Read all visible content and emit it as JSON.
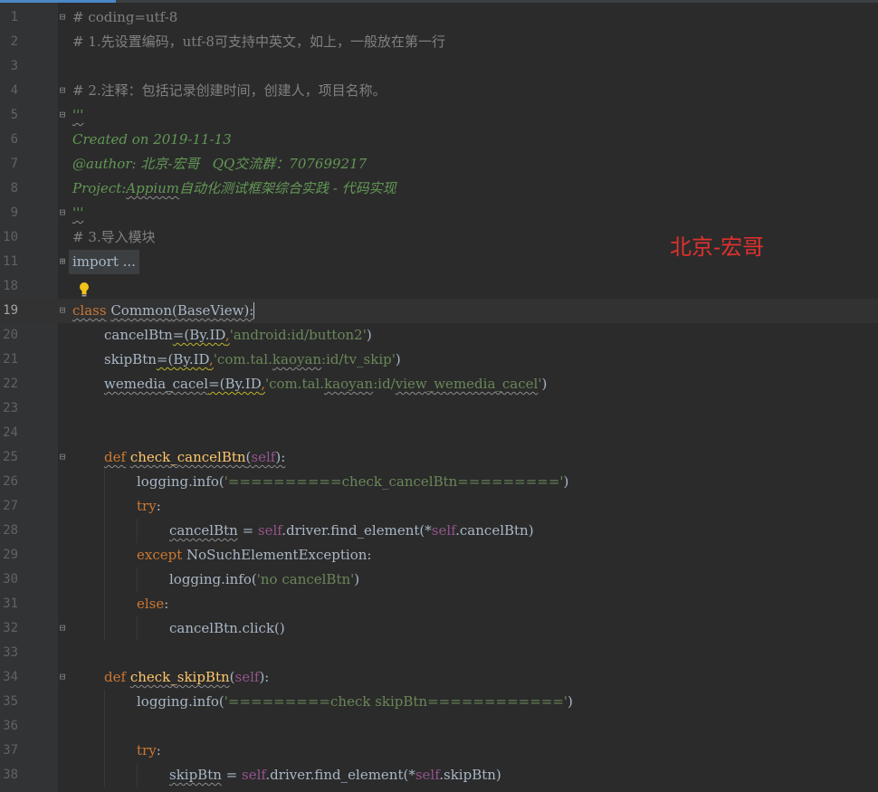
{
  "watermark": "北京-宏哥",
  "line_numbers": [
    "1",
    "2",
    "3",
    "4",
    "5",
    "6",
    "7",
    "8",
    "9",
    "10",
    "11",
    "18",
    "19",
    "20",
    "21",
    "22",
    "23",
    "24",
    "25",
    "26",
    "27",
    "28",
    "29",
    "30",
    "31",
    "32",
    "33",
    "34",
    "35",
    "36",
    "37",
    "38"
  ],
  "code": {
    "l1": "# coding=utf-8",
    "l2": "# 1.先设置编码，utf-8可支持中英文，如上，一般放在第一行",
    "l4": "# 2.注释：包括记录创建时间，创建人，项目名称。",
    "l5": "'''",
    "l6": "Created on 2019-11-13",
    "l7": "@author: 北京-宏哥   QQ交流群：707699217",
    "l8a": "Project:",
    "l8b": "Appium",
    "l8c": "自动化测试框架综合实践 - 代码实现",
    "l9": "'''",
    "l10": "# 3.导入模块",
    "l11": "import ...",
    "l19_kw": "class",
    "l19_name": "Common",
    "l19_rest": "(BaseView):",
    "l20_a": "cancelBtn",
    "l20_b": "=(By.ID",
    "l20_c": ",",
    "l20_d": "'android:id/button2'",
    "l20_e": ")",
    "l21_a": "skipBtn",
    "l21_b": "=(By.ID",
    "l21_c": ",",
    "l21_d1": "'com.tal.",
    "l21_d2": "kaoyan",
    "l21_d3": ":id/tv_skip'",
    "l21_e": ")",
    "l22_a": "wemedia_cacel",
    "l22_b": "=(By.ID",
    "l22_c": ",",
    "l22_d1": "'com.tal.",
    "l22_d2": "kaoyan",
    "l22_d3": ":id/",
    "l22_d4": "view_wemedia_cacel",
    "l22_d5": "'",
    "l22_e": ")",
    "def": "def",
    "l25_name": "check_cancelBtn",
    "l25_p1": "(",
    "self": "self",
    "l25_p2": "):",
    "l26_a": "logging.info(",
    "l26_b": "'==========check_cancelBtn========='",
    "close_paren": ")",
    "try": "try",
    "colon": ":",
    "l28_a": "cancelBtn",
    "l28_b": " = ",
    "l28_c": ".driver.find_element(*",
    "l28_d": ".cancelBtn)",
    "except": "except",
    "l29_b": " NoSuchElementException:",
    "l30_b": "'no cancelBtn'",
    "else": "else",
    "l32": "cancelBtn.click()",
    "l34_name": "check_skipBtn",
    "l35_b": "'=========check skipBtn============'",
    "l38_a": "skipBtn",
    "l38_d": ".skipBtn)"
  },
  "colors": {
    "background": "#2b2b2b",
    "keyword": "#cc7832",
    "string": "#6a8759",
    "docstring": "#629755",
    "comment": "#808080",
    "self": "#94558d",
    "watermark": "#e0312e"
  }
}
